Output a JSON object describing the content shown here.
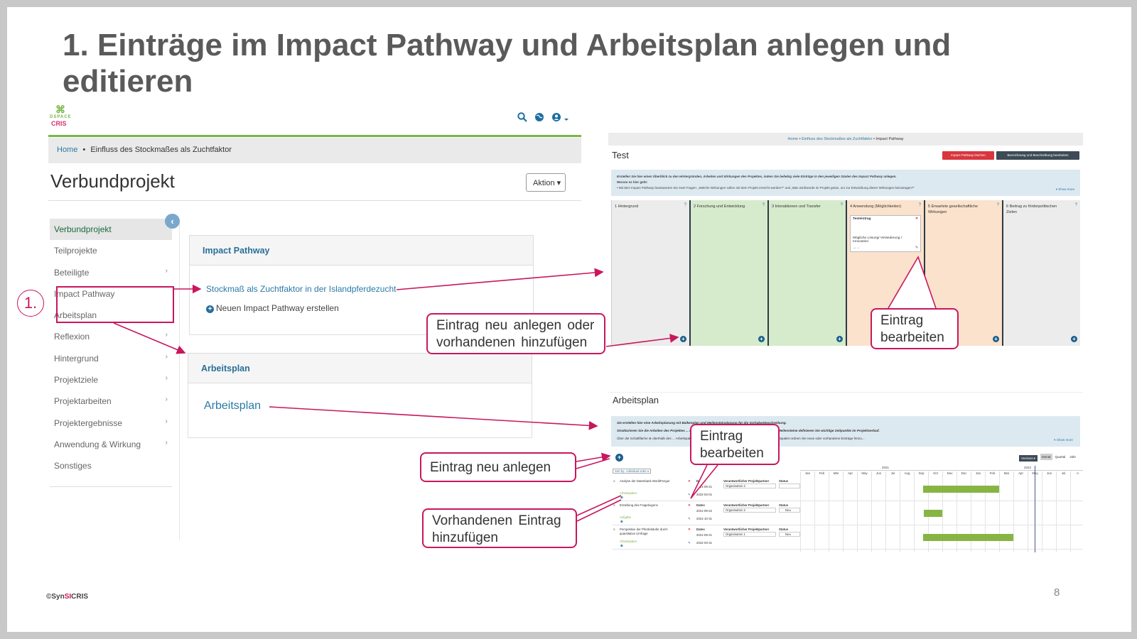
{
  "slide": {
    "title": "1. Einträge im Impact Pathway und Arbeitsplan anlegen und editieren",
    "page_number": "8",
    "copyright_prefix": "©Syn",
    "copyright_si": "SI",
    "copyright_suffix": "CRIS",
    "step_number": "1."
  },
  "dspace": {
    "logo_top": "DSPACE",
    "logo_bottom": "CRIS",
    "breadcrumb_home": "Home",
    "breadcrumb_sep": "•",
    "breadcrumb_current": "Einfluss des Stockmaßes als Zuchtfaktor",
    "page_title": "Verbundprojekt",
    "aktion_label": "Aktion ▾",
    "sidebar": [
      {
        "label": "Verbundprojekt",
        "chevron": ""
      },
      {
        "label": "Teilprojekte",
        "chevron": ""
      },
      {
        "label": "Beteiligte",
        "chevron": "›"
      },
      {
        "label": "Impact Pathway",
        "chevron": ""
      },
      {
        "label": "Arbeitsplan",
        "chevron": ""
      },
      {
        "label": "Reflexion",
        "chevron": "›"
      },
      {
        "label": "Hintergrund",
        "chevron": "›"
      },
      {
        "label": "Projektziele",
        "chevron": "›"
      },
      {
        "label": "Projektarbeiten",
        "chevron": "›"
      },
      {
        "label": "Projektergebnisse",
        "chevron": "›"
      },
      {
        "label": "Anwendung & Wirkung",
        "chevron": "›"
      },
      {
        "label": "Sonstiges",
        "chevron": ""
      }
    ],
    "impact_panel_title": "Impact Pathway",
    "impact_link": "Stockmaß als Zuchtfaktor in der Islandpferdezucht",
    "impact_new": "Neuen Impact Pathway erstellen",
    "arbeitsplan_panel_title": "Arbeitsplan",
    "arbeitsplan_link": "Arbeitsplan"
  },
  "callouts": {
    "neu_anlegen_oder": "Eintrag neu anlegen oder vorhandenen hinzufügen",
    "bearbeiten_ip": "Eintrag bearbeiten",
    "bearbeiten_ap": "Eintrag bearbeiten",
    "neu_anlegen": "Eintrag neu anlegen",
    "vorhandenen": "Vorhandenen Eintrag hinzufügen"
  },
  "impact_pathway": {
    "bc_home": "Home",
    "bc_project": "Einfluss des Stockmaßes als Zuchtfaktor",
    "bc_current": "Impact Pathway",
    "title": "Test",
    "delete_button": "Impact Pathway löschen",
    "edit_button": "Bezeichnung und Beschreibung bearbeiten",
    "info_line1": "Erstellen Sie hier einen Überblick zu den Hintergründen, Arbeiten und Wirkungen des Projektes, indem Sie beliebig viele Einträge in den jeweiligen Säulen des Impact Pathway anlegen.",
    "info_line2": "Worum es hier geht:",
    "info_line3": "• Mit dem Impact Pathway beantworten Sie zwei Fragen: „Welche Wirkungen sollen mit dem Projekt erreicht werden?\" und „Was wird/wurde im Projekt getan, um zur Entwicklung dieser Wirkungen beizutragen?\"",
    "show_more": "▾ Show more",
    "columns": [
      {
        "label": "1 Hintergrund",
        "color": "#ececec"
      },
      {
        "label": "2 Forschung und Entwicklung",
        "color": "#d5ebcc"
      },
      {
        "label": "3 Interaktionen und Transfer",
        "color": "#d5ebcc"
      },
      {
        "label": "4 Anwendung (Möglichkeiten)",
        "color": "#fbe2cc"
      },
      {
        "label": "5 Erwartete gesellschaftliche Wirkungen",
        "color": "#fbe2cc"
      },
      {
        "label": "6 Beitrag zu förderpolitischen Zielen",
        "color": "#ececec"
      }
    ],
    "card_title": "Testeintrag",
    "card_text": "Mögliche Lösung/ Veränderung / Innovation"
  },
  "arbeitsplan": {
    "title": "Arbeitsplan",
    "info_line1": "Sie erstellen hier eine Arbeitsplanung mit Balkenplan und Meilensteinplanung für die Vorhabenbeschreibung.",
    "info_line2": "Strukturieren Sie die Arbeiten des Projektes ... Legen Sie Zeiträume und Verantwortlichkeiten fest. Über Meilensteine definieren Sie wichtige Zeitpunkte im Projektverlauf.",
    "info_line3": "Über die Schaltfläche ⊕ oberhalb des ... Arbeitspakete und Meilensteine hinzu. Über die Schaltfläche ⊕ im Arbeitspaket ordnen Sie neue oder vorhandene Einträge hinzu...",
    "show_more": "▾ Show more",
    "versionen": "Versions ▾",
    "zoom": [
      "Monat",
      "Quartal",
      "Jahr"
    ],
    "sort_by": "Sort by.. individual order ▾",
    "years": [
      "2021",
      "2022"
    ],
    "months": [
      "Jan",
      "Feb",
      "Mär",
      "Apr",
      "May",
      "Jun",
      "Jul",
      "Aug",
      "Sep",
      "Oct",
      "Nov",
      "Dec",
      "Jan",
      "Feb",
      "Mar",
      "Apr",
      "May",
      "Jun",
      "Jul",
      "A"
    ],
    "rows": [
      {
        "task": "Analyse der Datenbank WorldFengur",
        "type": "Arbeitspaket",
        "dates_label": "Dates",
        "start": "2021-09-21",
        "end": "2022-03-01",
        "resp_label": "Verantwortlicher Projektpartner",
        "org": "Organisation 2",
        "status_label": "Status",
        "status": ""
      },
      {
        "task": "Erstellung des Fragebogens",
        "type": "Aufgabe",
        "dates_label": "Dates",
        "start": "2021-09-22",
        "end": "2021-10-31",
        "resp_label": "Verantwortlicher Projektpartner",
        "org": "Organisation 2",
        "status_label": "Status",
        "status": "Neu"
      },
      {
        "task": "Perspektive der Pferdekäufer durch quantitative Umfrage",
        "type": "Arbeitspaket",
        "dates_label": "Dates",
        "start": "2021-09-21",
        "end": "2022-03-31",
        "resp_label": "Verantwortlicher Projektpartner",
        "org": "Organisation 1",
        "status_label": "Status",
        "status": "Neu"
      }
    ]
  },
  "colors": {
    "accent_red": "#c8175d",
    "link_blue": "#2a7aa6",
    "dspace_green": "#7ab648",
    "gantt_bar": "#86b544"
  }
}
